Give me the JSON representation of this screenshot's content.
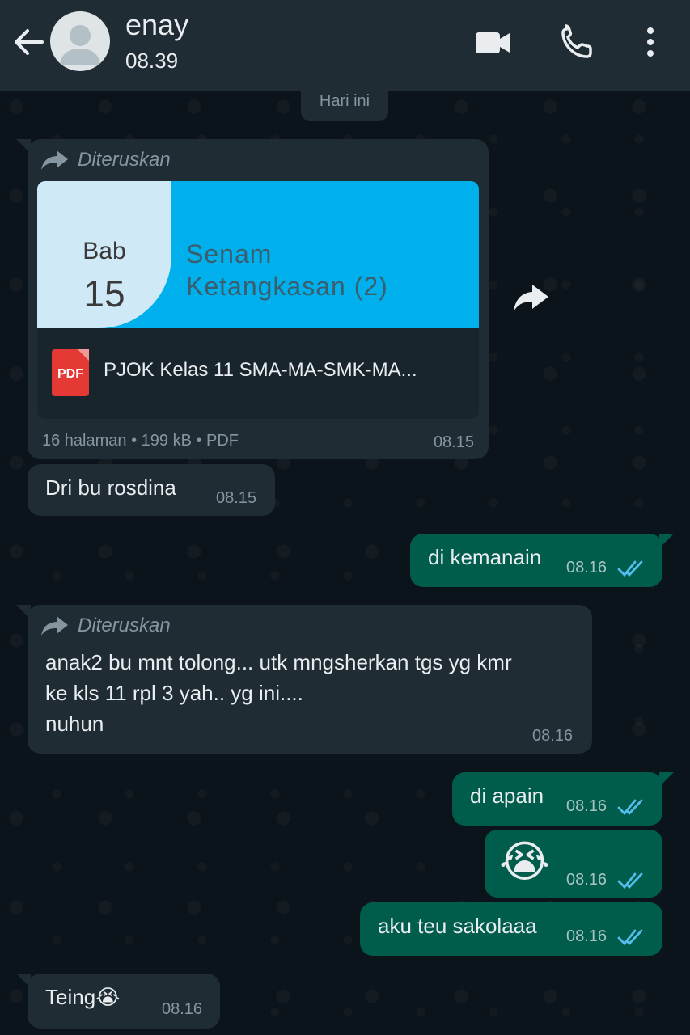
{
  "header": {
    "contact_name": "enay",
    "status": "08.39",
    "icons": [
      "back-arrow-icon",
      "avatar-icon",
      "video-call-icon",
      "phone-call-icon",
      "more-options-icon"
    ]
  },
  "date_chip": "Hari ini",
  "messages": [
    {
      "direction": "incoming",
      "forwarded_label": "Diteruskan",
      "document": {
        "thumb_word": "Bab",
        "thumb_number": "15",
        "thumb_title_line1": "Senam",
        "thumb_title_line2": "Ketangkasan (2)",
        "file_type_badge": "PDF",
        "file_name": "PJOK Kelas 11 SMA-MA-SMK-MA...",
        "meta": "16 halaman • 199 kB • PDF"
      },
      "time": "08.15"
    },
    {
      "direction": "incoming",
      "text": "Dri bu rosdina",
      "time": "08.15"
    },
    {
      "direction": "outgoing",
      "text": "di kemanain",
      "time": "08.16",
      "status": "read"
    },
    {
      "direction": "incoming",
      "forwarded_label": "Diteruskan",
      "text_line1": "anak2 bu mnt tolong... utk mngsherkan tgs yg kmr",
      "text_line2": "ke kls 11 rpl 3 yah.. yg ini....",
      "text_line3": "nuhun",
      "time": "08.16"
    },
    {
      "direction": "outgoing",
      "text": "di apain",
      "time": "08.16",
      "status": "read"
    },
    {
      "direction": "outgoing",
      "emoji": "😭",
      "time": "08.16",
      "status": "read"
    },
    {
      "direction": "outgoing",
      "text": "aku teu sakolaaa",
      "time": "08.16",
      "status": "read"
    },
    {
      "direction": "incoming",
      "text": "Teing😭",
      "time": "08.16"
    }
  ],
  "colors": {
    "header_bg": "#1f2c34",
    "chat_bg": "#0b141a",
    "incoming_bubble": "#1f2c34",
    "outgoing_bubble": "#005c4b",
    "read_ticks": "#53bdeb"
  }
}
